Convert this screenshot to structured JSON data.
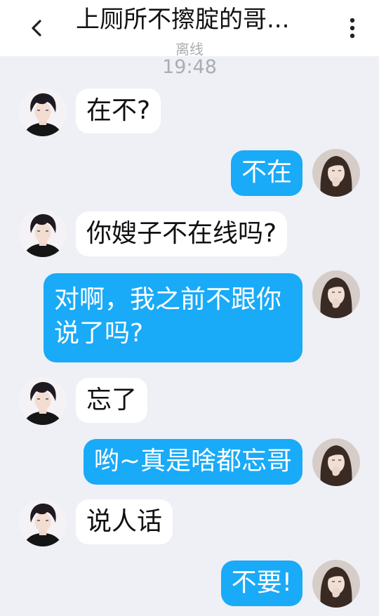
{
  "header": {
    "title": "上厕所不擦腚的哥...",
    "status": "离线",
    "back_icon": "chevron-left-icon",
    "more_icon": "more-vertical-icon"
  },
  "timestamp": "19:48",
  "colors": {
    "background": "#eef0f6",
    "outgoing_bubble": "#19aaf8",
    "incoming_bubble": "#ffffff"
  },
  "messages": [
    {
      "sender": "contact",
      "text": "在不?"
    },
    {
      "sender": "me",
      "text": "不在"
    },
    {
      "sender": "contact",
      "text": "你嫂子不在线吗?"
    },
    {
      "sender": "me",
      "text": "对啊，我之前不跟你说了吗?"
    },
    {
      "sender": "contact",
      "text": "忘了"
    },
    {
      "sender": "me",
      "text": "哟~真是啥都忘哥"
    },
    {
      "sender": "contact",
      "text": "说人话"
    },
    {
      "sender": "me",
      "text": "不要!"
    }
  ]
}
